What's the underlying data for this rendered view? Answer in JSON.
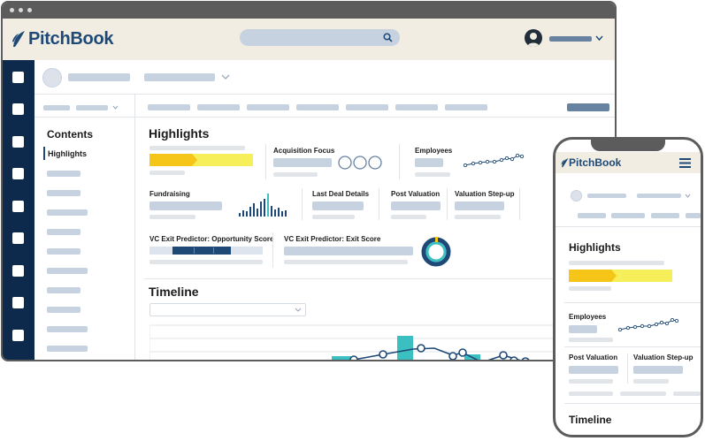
{
  "brand": {
    "name": "PitchBook",
    "color": "#1e4976",
    "nav_color": "#0d2a4c",
    "bar_color": "#f1ede2",
    "yellow": "#f5c518",
    "teal": "#3bbfc0",
    "blue": "#1e4976"
  },
  "icons": {
    "search": "search-icon",
    "user": "user-avatar-icon",
    "chevron": "chevron-down-icon",
    "menu": "hamburger-menu-icon",
    "logo": "pitchbook-leaf-icon"
  },
  "desktop": {
    "contents": {
      "title": "Contents",
      "active_item": "Highlights"
    },
    "highlights": {
      "title": "Highlights",
      "acquisition_focus": "Acquisition Focus",
      "employees": "Employees",
      "fundraising": "Fundraising",
      "last_deal_details": "Last Deal Details",
      "post_valuation": "Post Valuation",
      "valuation_step_up": "Valuation Step-up",
      "opportunity_score": "VC Exit Predictor: Opportunity Score",
      "exit_score": "VC Exit Predictor: Exit Score"
    },
    "timeline": {
      "title": "Timeline"
    }
  },
  "mobile": {
    "highlights_title": "Highlights",
    "employees": "Employees",
    "post_valuation": "Post Valuation",
    "valuation_step_up": "Valuation Step-up",
    "timeline_title": "Timeline"
  }
}
